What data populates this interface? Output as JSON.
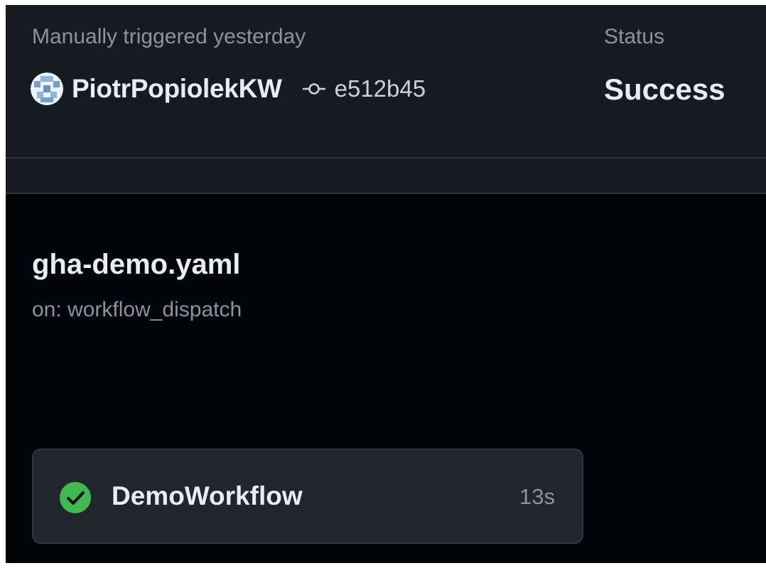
{
  "summary": {
    "trigger_text": "Manually triggered yesterday",
    "actor": {
      "name": "PiotrPopiolekKW",
      "avatar_icon": "identicon-avatar"
    },
    "commit": {
      "icon": "git-commit-icon",
      "sha": "e512b45"
    },
    "status": {
      "label": "Status",
      "value": "Success"
    }
  },
  "workflow": {
    "file_name": "gha-demo.yaml",
    "event": "on: workflow_dispatch"
  },
  "jobs": [
    {
      "icon": "check-circle-icon",
      "name": "DemoWorkflow",
      "duration": "13s",
      "status_color": "#3fb950"
    }
  ],
  "colors": {
    "background": "#010409",
    "panel": "#161b22",
    "card": "#21262d",
    "border": "#30363d",
    "text_primary": "#e6edf3",
    "text_muted": "#8b949e",
    "success": "#3fb950"
  }
}
